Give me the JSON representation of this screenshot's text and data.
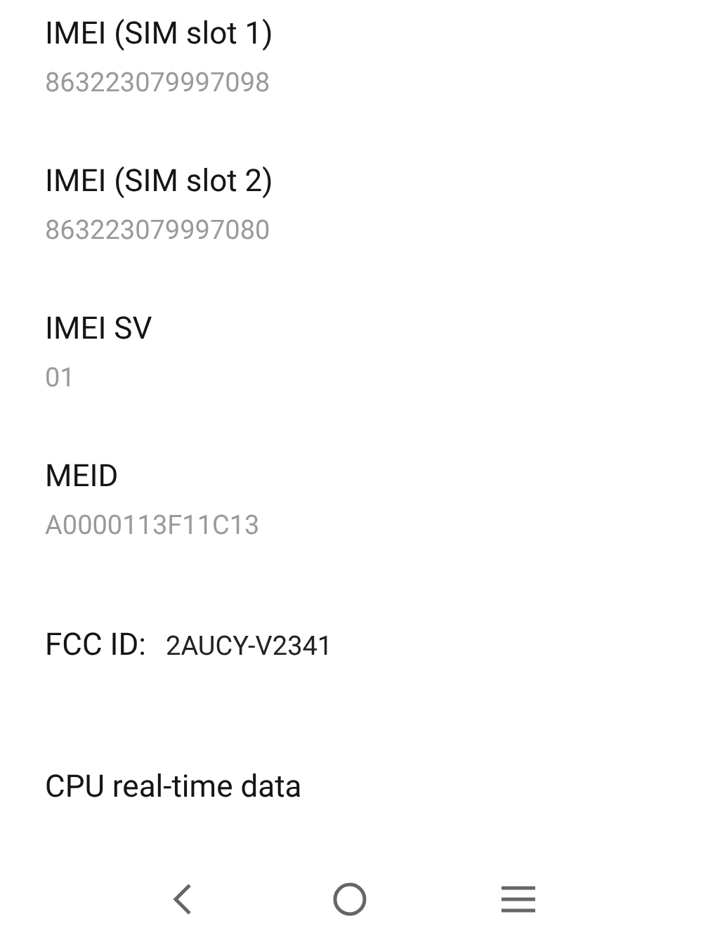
{
  "items": [
    {
      "kind": "stacked",
      "label": "IMEI (SIM slot 1)",
      "value": "863223079997098"
    },
    {
      "kind": "stacked",
      "label": "IMEI (SIM slot 2)",
      "value": "863223079997080"
    },
    {
      "kind": "stacked",
      "label": "IMEI SV",
      "value": "01"
    },
    {
      "kind": "stacked",
      "label": "MEID",
      "value": "A0000113F11C13"
    },
    {
      "kind": "inline",
      "label": "FCC ID:",
      "value": "2AUCY-V2341"
    },
    {
      "kind": "title",
      "label": "CPU real-time data"
    }
  ]
}
